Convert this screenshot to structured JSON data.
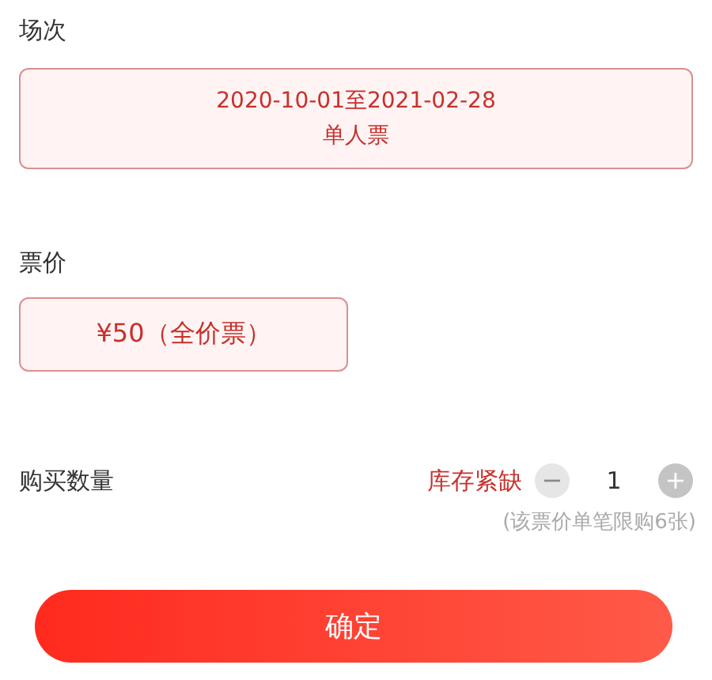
{
  "session": {
    "label": "场次",
    "option": {
      "lines": [
        "2020-10-01至2021-02-28",
        "单人票"
      ],
      "selected": true
    }
  },
  "price": {
    "label": "票价",
    "option": {
      "lines": [
        "¥50（全价票）"
      ],
      "selected": true
    }
  },
  "quantity": {
    "label": "购买数量",
    "stock_status": "库存紧缺",
    "minus": {
      "symbol": "−",
      "disabled": true
    },
    "value": "1",
    "plus": {
      "symbol": "+",
      "disabled": false
    },
    "note": "(该票价单笔限购6张)"
  },
  "confirm_button": "确定"
}
